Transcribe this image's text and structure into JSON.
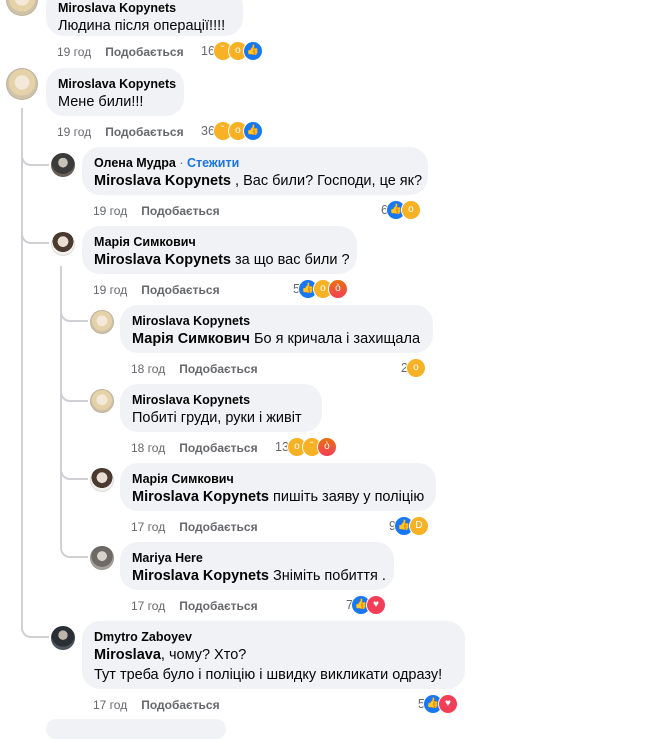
{
  "comments": [
    {
      "author": "Miroslava Kopynets",
      "text": "Людина після операції!!!!",
      "time": "19 год",
      "like": "Подобається",
      "count": "16",
      "reactions": [
        "sad-icon",
        "wow-icon",
        "like-icon"
      ]
    },
    {
      "author": "Miroslava Kopynets",
      "text": "Мене били!!!",
      "time": "19 год",
      "like": "Подобається",
      "count": "36",
      "reactions": [
        "sad-icon",
        "wow-icon",
        "like-icon"
      ]
    },
    {
      "author": "Олена Мудра",
      "follow": "Стежити",
      "mention": "Miroslava Kopynets",
      "text": " , Вас били? Господи, це як?",
      "time": "19 год",
      "like": "Подобається",
      "count": "6",
      "reactions": [
        "like-icon",
        "wow-icon"
      ]
    },
    {
      "author": "Марія Симкович",
      "mention": "Miroslava Kopynets",
      "text": " за що вас били ?",
      "time": "19 год",
      "like": "Подобається",
      "count": "5",
      "reactions": [
        "like-icon",
        "wow-icon",
        "angry-icon"
      ]
    },
    {
      "author": "Miroslava Kopynets",
      "mention": "Марія Симкович",
      "text": " Бо я кричала і захищала",
      "time": "18 год",
      "like": "Подобається",
      "count": "2",
      "reactions": [
        "wow-icon"
      ]
    },
    {
      "author": "Miroslava Kopynets",
      "text": "Побиті груди, руки і живіт",
      "time": "18 год",
      "like": "Подобається",
      "count": "13",
      "reactions": [
        "wow-icon",
        "sad-icon",
        "angry-icon"
      ]
    },
    {
      "author": "Марія Симкович",
      "mention": "Miroslava Kopynets",
      "text": " пишіть заяву у поліцію",
      "time": "17 год",
      "like": "Подобається",
      "count": "9",
      "reactions": [
        "like-icon",
        "haha-icon"
      ]
    },
    {
      "author": "Mariya Here",
      "mention": "Miroslava Kopynets",
      "text": " Зніміть побиття .",
      "time": "17 год",
      "like": "Подобається",
      "count": "7",
      "reactions": [
        "like-icon",
        "love-icon"
      ]
    },
    {
      "author": "Dmytro Zaboyev",
      "mention": "Miroslava",
      "text": ", чому? Хто?",
      "text2": "Тут треба було і поліцію і швидку викликати одразу!",
      "time": "17 год",
      "like": "Подобається",
      "count": "5",
      "reactions": [
        "like-icon",
        "love-icon"
      ]
    }
  ],
  "colors": {
    "bubble": "#f0f2f5",
    "link": "#1b74e4",
    "meta": "#65676b",
    "thread": "#ced0d4"
  }
}
